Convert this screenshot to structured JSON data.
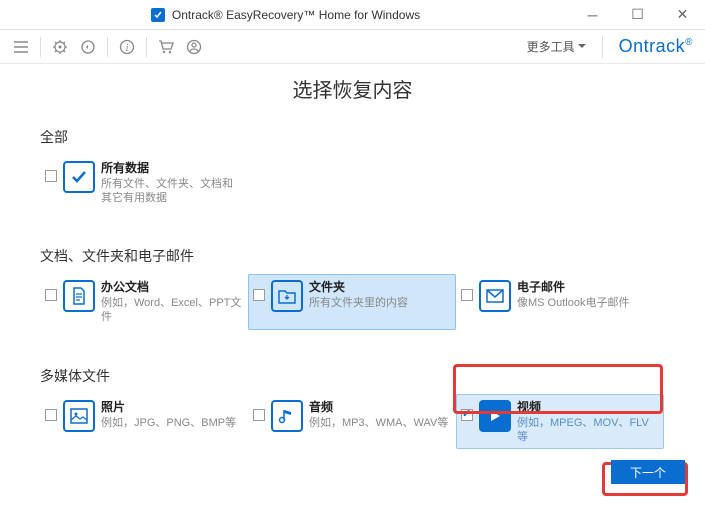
{
  "titlebar": {
    "title": "Ontrack® EasyRecovery™ Home for Windows"
  },
  "toolbar": {
    "more_tools": "更多工具",
    "brand": "Ontrack",
    "brand_suffix": "®"
  },
  "page": {
    "title": "选择恢复内容"
  },
  "sections": {
    "all": {
      "title": "全部",
      "items": {
        "all_data": {
          "title": "所有数据",
          "desc": "所有文件、文件夹、文档和其它有用数据"
        }
      }
    },
    "docs": {
      "title": "文档、文件夹和电子邮件",
      "items": {
        "office": {
          "title": "办公文档",
          "desc": "例如，Word、Excel、PPT文件"
        },
        "folder": {
          "title": "文件夹",
          "desc": "所有文件夹里的内容"
        },
        "email": {
          "title": "电子邮件",
          "desc": "像MS Outlook电子邮件"
        }
      }
    },
    "media": {
      "title": "多媒体文件",
      "items": {
        "photo": {
          "title": "照片",
          "desc": "例如，JPG、PNG、BMP等"
        },
        "audio": {
          "title": "音频",
          "desc": "例如，MP3、WMA、WAV等"
        },
        "video": {
          "title": "视频",
          "desc": "例如，MPEG、MOV、FLV等"
        }
      }
    }
  },
  "buttons": {
    "next": "下一个"
  }
}
